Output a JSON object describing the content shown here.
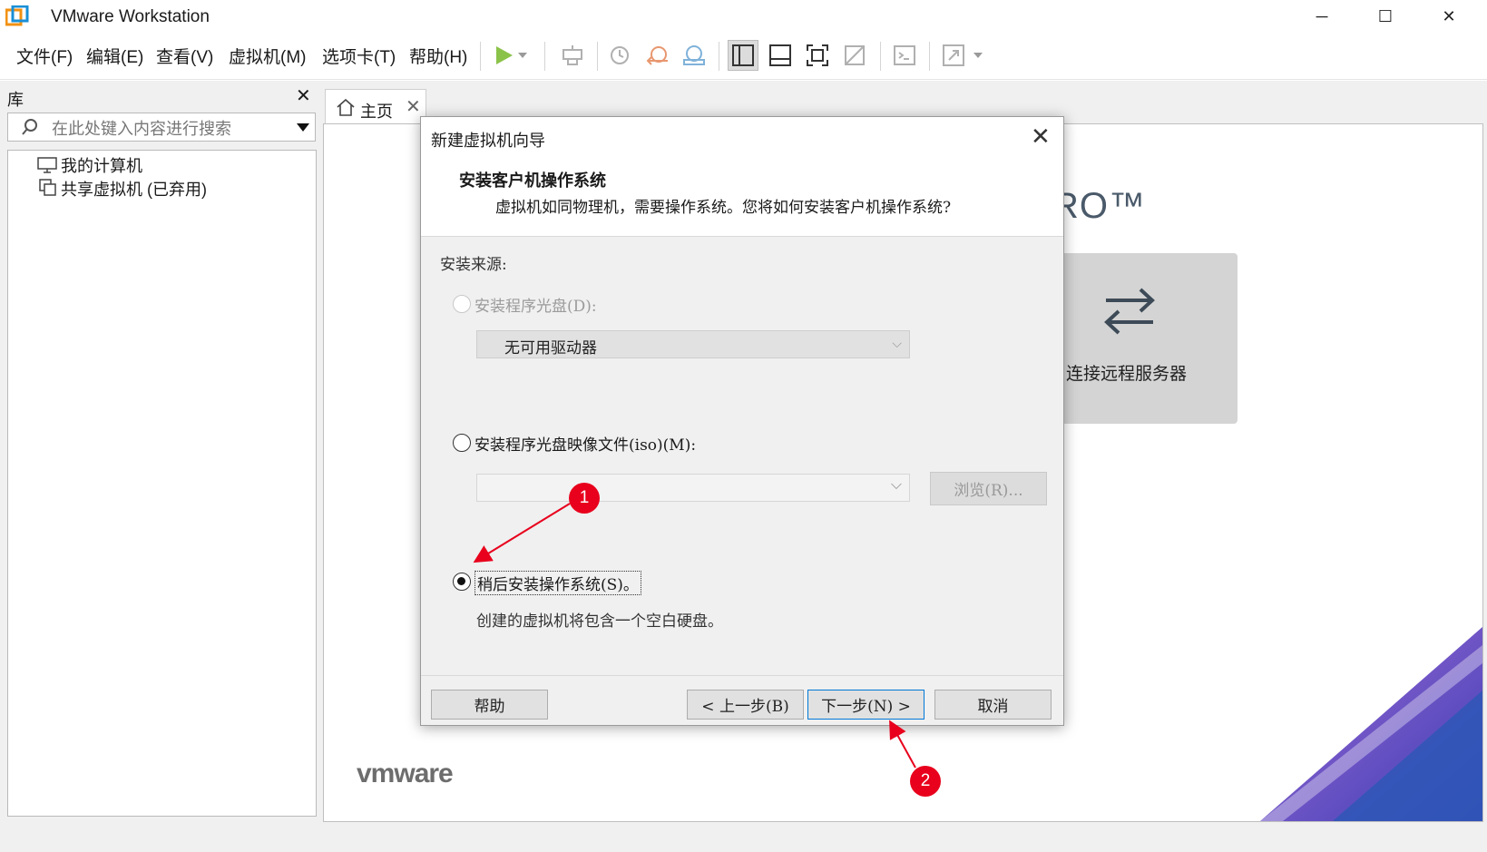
{
  "window": {
    "title": "VMware Workstation",
    "minimize_glyph": "─",
    "maximize_glyph": "☐",
    "close_glyph": "✕"
  },
  "menu": [
    "文件(F)",
    "编辑(E)",
    "查看(V)",
    "虚拟机(M)",
    "选项卡(T)",
    "帮助(H)"
  ],
  "toolbar": {
    "icons": [
      "play-icon",
      "dropdown-icon",
      "send-keys-icon",
      "snapshot-take-icon",
      "snapshot-revert-icon",
      "snapshot-manager-icon",
      "library-view-icon",
      "thumbnail-view-icon",
      "fullscreen-icon",
      "unity-icon",
      "console-icon",
      "stretch-icon"
    ]
  },
  "library": {
    "title": "库",
    "close_glyph": "✕",
    "search_placeholder": "在此处键入内容进行搜索",
    "items": [
      "我的计算机",
      "共享虚拟机 (已弃用)"
    ]
  },
  "tab": {
    "label": "主页",
    "close_glyph": "✕"
  },
  "home": {
    "brand_suffix": "RO™",
    "remote_label": "连接远程服务器",
    "logo": "vmware"
  },
  "dialog": {
    "title": "新建虚拟机向导",
    "close_glyph": "✕",
    "heading": "安装客户机操作系统",
    "description": "虚拟机如同物理机，需要操作系统。您将如何安装客户机操作系统?",
    "install_source": "安装来源:",
    "options": [
      {
        "label": "安装程序光盘(D):",
        "selected": false,
        "enabled": false
      },
      {
        "label": "安装程序光盘映像文件(iso)(M):",
        "selected": false,
        "enabled": true
      },
      {
        "label": "稍后安装操作系统(S)。",
        "selected": true,
        "enabled": true
      }
    ],
    "drive_value": "无可用驱动器",
    "iso_value": "",
    "browse_label": "浏览(R)...",
    "later_description": "创建的虚拟机将包含一个空白硬盘。",
    "buttons": {
      "help": "帮助",
      "back": "< 上一步(B)",
      "next": "下一步(N) >",
      "cancel": "取消"
    }
  },
  "annotations": {
    "badge1": "1",
    "badge2": "2",
    "color": "#e8001c"
  }
}
